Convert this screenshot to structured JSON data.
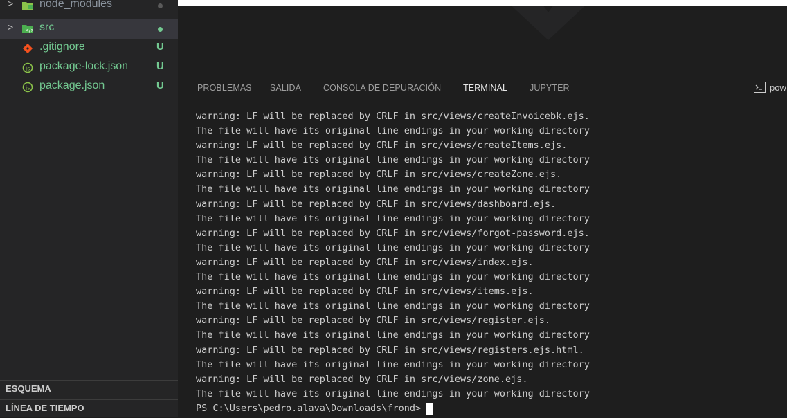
{
  "explorer": {
    "items": [
      {
        "name": "node_modules",
        "chevron": ">",
        "status": "",
        "color": "#8b949e",
        "icon": "folder-node-icon"
      },
      {
        "name": "src",
        "chevron": ">",
        "status": "",
        "color": "#73c991",
        "icon": "folder-src-icon"
      },
      {
        "name": ".gitignore",
        "chevron": "",
        "status": "U",
        "color": "#73c991",
        "icon": "git-icon"
      },
      {
        "name": "package-lock.json",
        "chevron": "",
        "status": "U",
        "color": "#73c991",
        "icon": "nodejs-icon"
      },
      {
        "name": "package.json",
        "chevron": "",
        "status": "U",
        "color": "#73c991",
        "icon": "nodejs-icon"
      }
    ],
    "sections": [
      "ESQUEMA",
      "LÍNEA DE TIEMPO"
    ]
  },
  "panel": {
    "tabs": [
      {
        "label": "PROBLEMAS",
        "active": false
      },
      {
        "label": "SALIDA",
        "active": false
      },
      {
        "label": "CONSOLA DE DEPURACIÓN",
        "active": false
      },
      {
        "label": "TERMINAL",
        "active": true
      },
      {
        "label": "JUPYTER",
        "active": false
      }
    ],
    "terminal_selector": "pow"
  },
  "terminal": {
    "lines": [
      "warning: LF will be replaced by CRLF in src/views/createInvoicebk.ejs.",
      "The file will have its original line endings in your working directory",
      "warning: LF will be replaced by CRLF in src/views/createItems.ejs.",
      "The file will have its original line endings in your working directory",
      "warning: LF will be replaced by CRLF in src/views/createZone.ejs.",
      "The file will have its original line endings in your working directory",
      "warning: LF will be replaced by CRLF in src/views/dashboard.ejs.",
      "The file will have its original line endings in your working directory",
      "warning: LF will be replaced by CRLF in src/views/forgot-password.ejs.",
      "The file will have its original line endings in your working directory",
      "warning: LF will be replaced by CRLF in src/views/index.ejs.",
      "The file will have its original line endings in your working directory",
      "warning: LF will be replaced by CRLF in src/views/items.ejs.",
      "The file will have its original line endings in your working directory",
      "warning: LF will be replaced by CRLF in src/views/register.ejs.",
      "The file will have its original line endings in your working directory",
      "warning: LF will be replaced by CRLF in src/views/registers.ejs.html.",
      "The file will have its original line endings in your working directory",
      "warning: LF will be replaced by CRLF in src/views/zone.ejs.",
      "The file will have its original line endings in your working directory"
    ],
    "prompt": "PS C:\\Users\\pedro.alava\\Downloads\\frond>"
  },
  "colors": {
    "untracked": "#73c991",
    "dimmed": "#8b949e",
    "foreground": "#cccccc"
  }
}
